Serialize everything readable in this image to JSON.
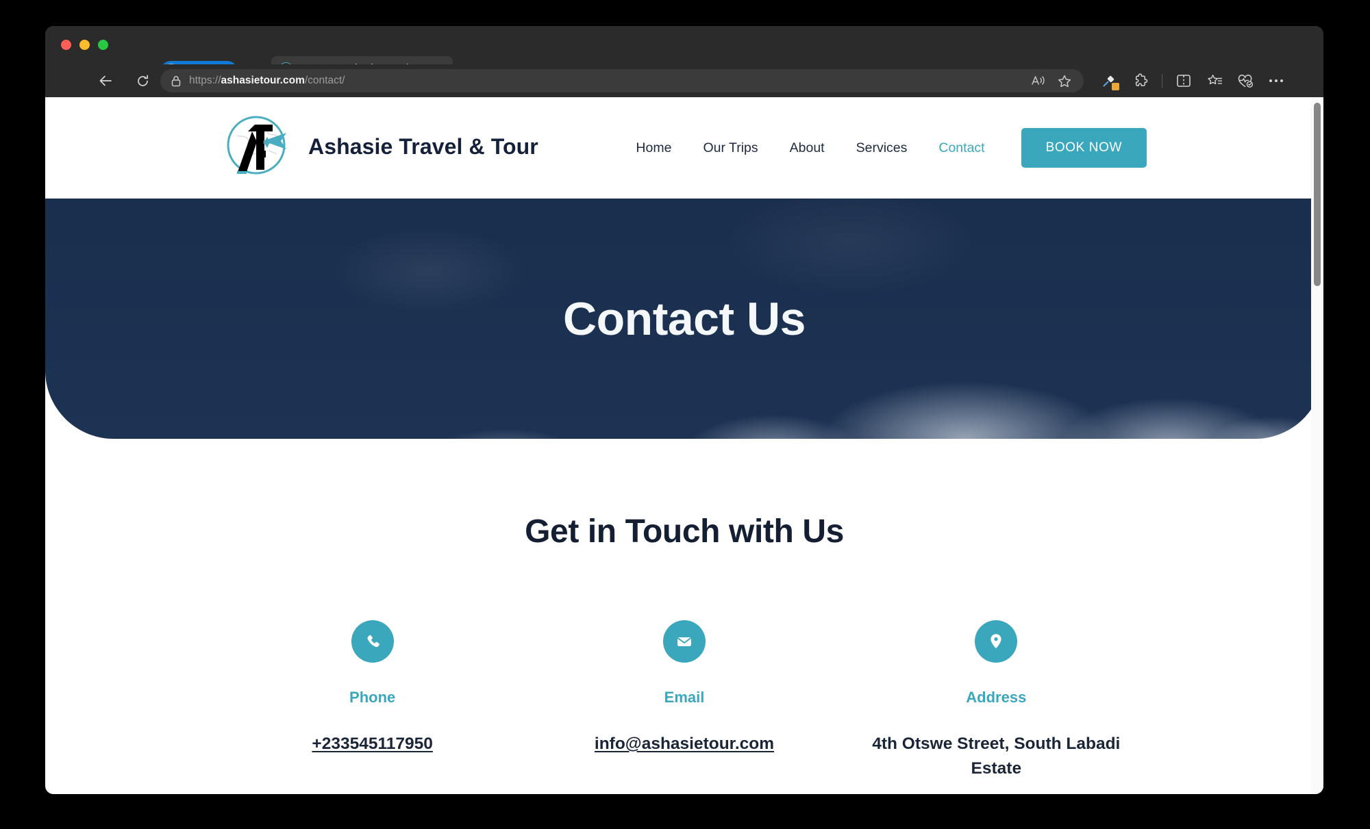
{
  "browser": {
    "profile_pill": "InPrivate",
    "tab": {
      "title": "Contact – Ashasie Travel & Tou",
      "favicon_name": "ashasie-favicon",
      "close_icon": "close-icon"
    },
    "new_tab_icon": "plus-icon",
    "tab_actions_icon": "tab-actions-icon",
    "back_icon": "back-arrow-icon",
    "reload_icon": "reload-icon",
    "url": {
      "scheme": "https://",
      "host": "ashasietour.com",
      "path": "/contact/",
      "lock_icon": "lock-icon"
    },
    "toolbar_icons": [
      "read-aloud-icon",
      "add-favorite-icon",
      "copilot-designer-icon",
      "extensions-icon",
      "split-screen-icon",
      "collections-icon",
      "browser-essentials-icon",
      "settings-and-more-icon"
    ]
  },
  "site": {
    "brand": "Ashasie Travel & Tour",
    "logo_name": "ashasie-globe-plane-logo",
    "nav": [
      {
        "label": "Home",
        "active": false
      },
      {
        "label": "Our Trips",
        "active": false
      },
      {
        "label": "About",
        "active": false
      },
      {
        "label": "Services",
        "active": false
      },
      {
        "label": "Contact",
        "active": true
      }
    ],
    "book_button": "BOOK NOW",
    "hero_title": "Contact Us",
    "section_title": "Get in Touch with Us",
    "cards": [
      {
        "icon": "phone-icon",
        "label": "Phone",
        "value": "+233545117950",
        "is_link": true
      },
      {
        "icon": "email-icon",
        "label": "Email",
        "value": "info@ashasietour.com",
        "is_link": true
      },
      {
        "icon": "map-pin-icon",
        "label": "Address",
        "value": "4th Otswe Street, South Labadi Estate",
        "is_link": false
      }
    ]
  },
  "colors": {
    "teal": "#3ba7bd",
    "navy": "#1d3354",
    "text_dark": "#141f33"
  }
}
